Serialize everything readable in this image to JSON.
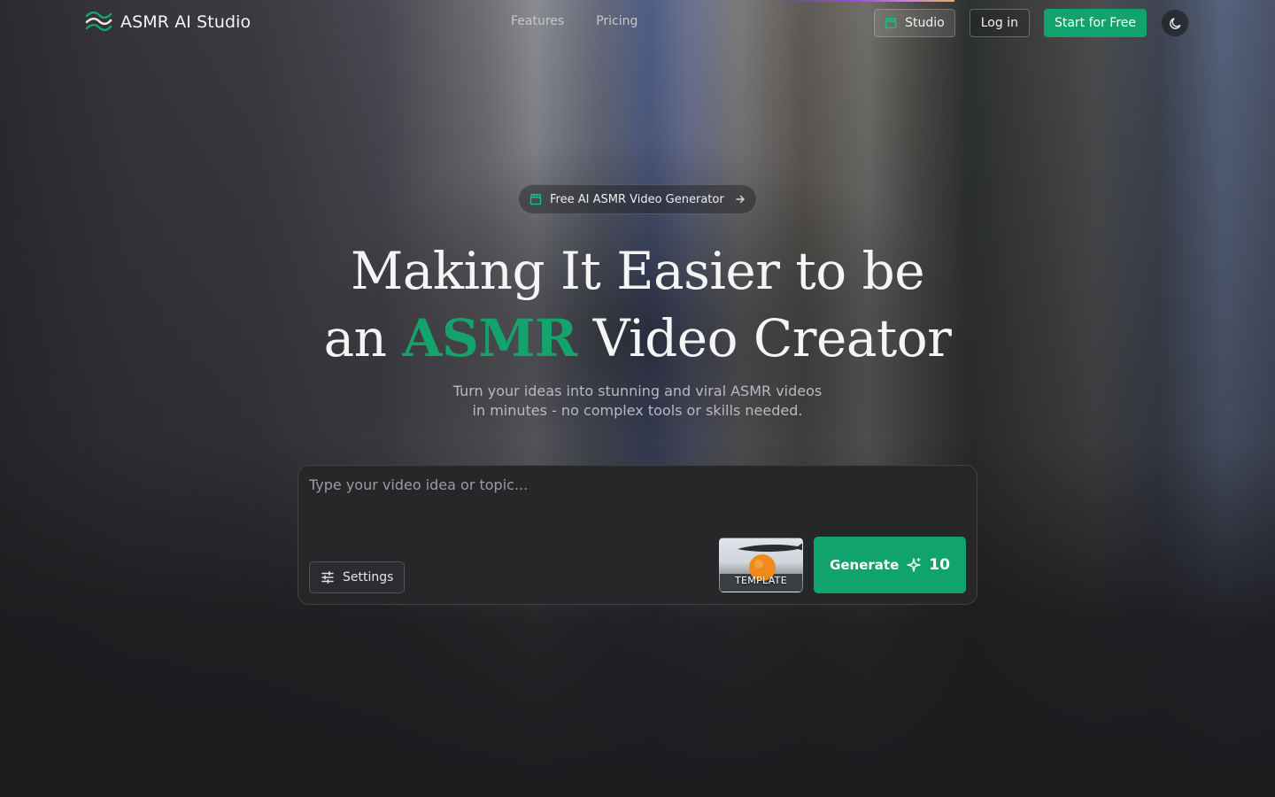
{
  "brand": {
    "name": "ASMR AI Studio",
    "color": "#10a36e"
  },
  "nav": {
    "features": "Features",
    "pricing": "Pricing"
  },
  "actions": {
    "studio": "Studio",
    "login": "Log in",
    "start": "Start for Free"
  },
  "badge": {
    "text": "Free AI ASMR Video Generator"
  },
  "hero": {
    "line1": "Making It Easier to be",
    "line2_pre": "an",
    "line2_accent": "ASMR",
    "line2_post": "Video Creator",
    "sub_line1": "Turn your ideas into stunning and viral ASMR videos",
    "sub_line2": "in minutes - no complex tools or skills needed."
  },
  "composer": {
    "placeholder": "Type your video idea or topic...",
    "settings_label": "Settings",
    "template_label": "TEMPLATE",
    "generate_label": "Generate",
    "credits": "10"
  },
  "icons": {
    "logo": "wave-logo-icon",
    "studio": "clapperboard-icon",
    "theme": "moon-icon",
    "badge": "clapperboard-icon",
    "arrow": "arrow-right-icon",
    "settings": "sliders-icon",
    "generate": "sparkle-icon"
  }
}
